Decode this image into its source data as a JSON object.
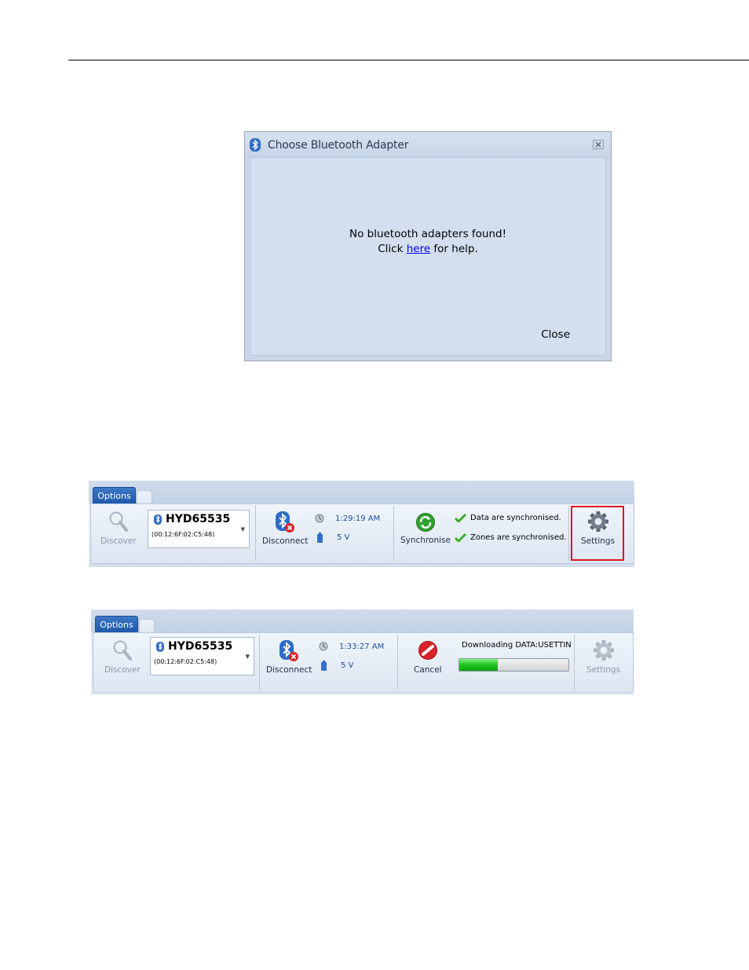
{
  "dialog": {
    "title": "Choose Bluetooth Adapter",
    "message_line1": "No bluetooth adapters found!",
    "message_line2_prefix": "Click ",
    "message_link": "here",
    "message_line2_suffix": " for help.",
    "close_label": "Close"
  },
  "toolbar1": {
    "tab_label": "Options",
    "discover_label": "Discover",
    "device_name": "HYD65535",
    "device_address": "(00:12:6F:02:C5:48)",
    "disconnect_label": "Disconnect",
    "time": "1:29:19 AM",
    "voltage": "5 V",
    "synchronise_label": "Synchronise",
    "status_data": "Data are synchronised.",
    "status_zones": "Zones are synchronised.",
    "settings_label": "Settings"
  },
  "toolbar2": {
    "tab_label": "Options",
    "discover_label": "Discover",
    "device_name": "HYD65535",
    "device_address": "(00:12:6F:02:C5:48)",
    "disconnect_label": "Disconnect",
    "time": "1:33:27 AM",
    "voltage": "5 V",
    "cancel_label": "Cancel",
    "download_label": "Downloading DATA:USETTIN",
    "progress_fraction": 0.35,
    "settings_label": "Settings"
  },
  "colors": {
    "highlight": "#e0141e",
    "progress": "#1fc51f",
    "tab": "#2a63b5",
    "link": "#0000ee"
  },
  "icons": [
    "bluetooth-icon",
    "close-x-icon",
    "magnifier-icon",
    "bluetooth-disconnect-icon",
    "clock-icon",
    "battery-icon",
    "sync-icon",
    "checkmark-icon",
    "gear-icon",
    "cancel-icon",
    "dropdown-caret-icon"
  ]
}
